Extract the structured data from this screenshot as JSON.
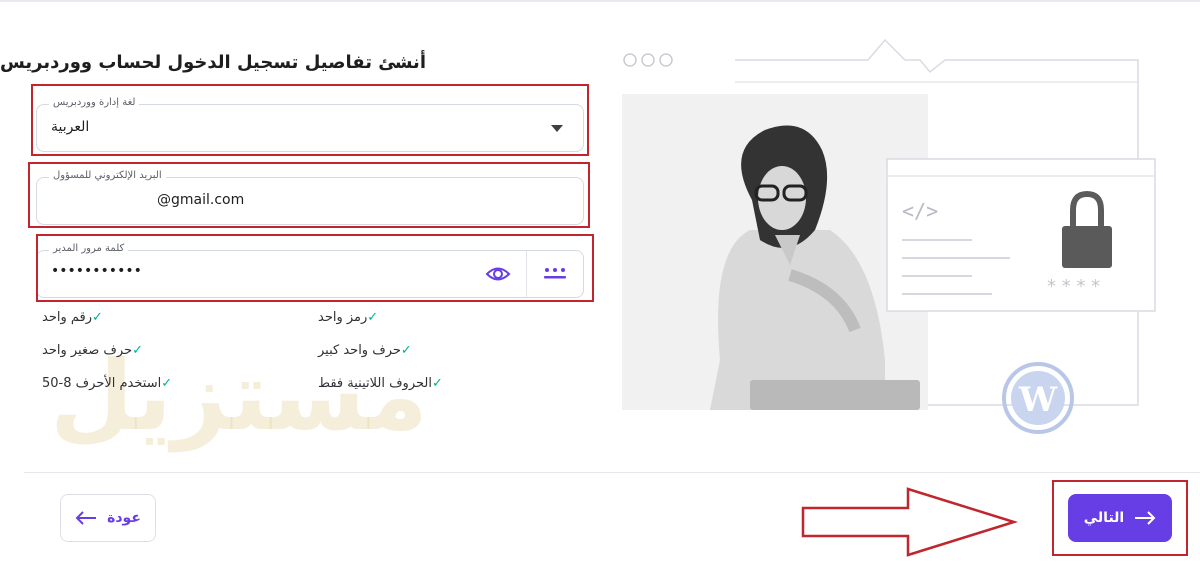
{
  "form": {
    "title": "أنشئ تفاصيل تسجيل الدخول لحساب ووردبريس",
    "language_label": "لغة إدارة ووردبريس",
    "language_value": "العربية",
    "email_label": "البريد الإلكتروني للمسؤول",
    "email_value": "@gmail.com",
    "password_label": "كلمة مرور المدير",
    "password_value": "•••••••••••"
  },
  "requirements": {
    "left": [
      "رقم واحد",
      "حرف صغير واحد",
      "استخدم الأحرف 8-50"
    ],
    "right": [
      "رمز واحد",
      "حرف واحد كبير",
      "الحروف اللاتينية فقط"
    ]
  },
  "footer": {
    "back_label": "عودة",
    "next_label": "التالي"
  },
  "watermark": {
    "text": "مستزيل"
  },
  "illustration": {
    "code_tag": "</>",
    "pin_mask": "* * * *"
  },
  "colors": {
    "accent": "#673de6",
    "check": "#00b090",
    "highlight": "#c0262d"
  }
}
